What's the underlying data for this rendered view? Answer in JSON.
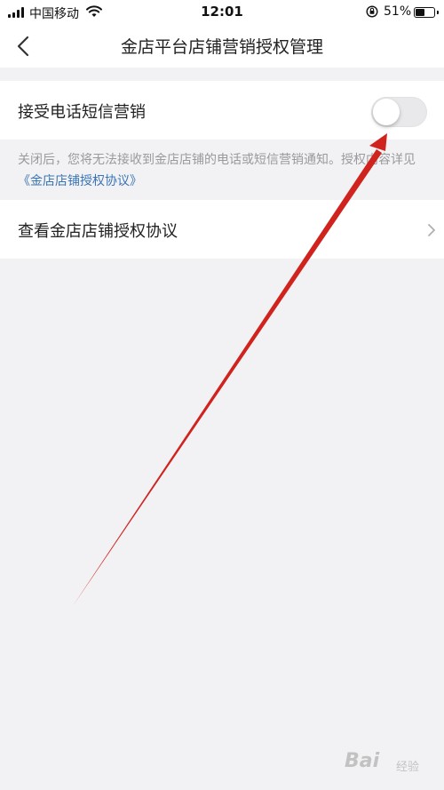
{
  "status_bar": {
    "carrier": "中国移动",
    "time": "12:01",
    "battery_percent": "51%",
    "icons": [
      "signal-icon",
      "wifi-icon",
      "orientation-lock-icon",
      "battery-icon"
    ]
  },
  "nav": {
    "title": "金店平台店铺营销授权管理",
    "back_icon": "chevron-left-icon"
  },
  "settings": {
    "toggle_row": {
      "label": "接受电话短信营销",
      "enabled": false
    },
    "hint": {
      "text": "关闭后，您将无法接收到金店店铺的电话或短信营销通知。授权内容详见",
      "link": "《金店店铺授权协议》"
    },
    "link_row": {
      "label": "查看金店店铺授权协议",
      "icon": "chevron-right-icon"
    }
  },
  "annotation": {
    "arrow_color": "#d0231e"
  },
  "watermark": {
    "brand": "Bai",
    "suffix": "经验"
  }
}
